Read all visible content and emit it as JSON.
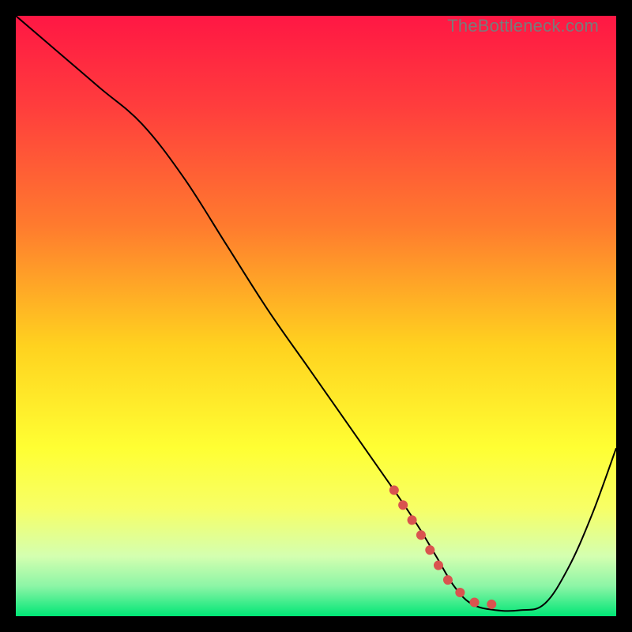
{
  "watermark": "TheBottleneck.com",
  "chart_data": {
    "type": "line",
    "title": "",
    "xlabel": "",
    "ylabel": "",
    "xlim": [
      0,
      100
    ],
    "ylim": [
      0,
      100
    ],
    "grid": false,
    "legend": false,
    "background_gradient": {
      "stops": [
        {
          "offset": 0.0,
          "color": "#ff1744"
        },
        {
          "offset": 0.15,
          "color": "#ff3d3d"
        },
        {
          "offset": 0.35,
          "color": "#ff7b2e"
        },
        {
          "offset": 0.55,
          "color": "#ffd21f"
        },
        {
          "offset": 0.72,
          "color": "#ffff33"
        },
        {
          "offset": 0.82,
          "color": "#f7ff66"
        },
        {
          "offset": 0.9,
          "color": "#d4ffb0"
        },
        {
          "offset": 0.95,
          "color": "#8cf5a6"
        },
        {
          "offset": 1.0,
          "color": "#00e676"
        }
      ]
    },
    "series": [
      {
        "name": "bottleneck-curve",
        "color": "#000000",
        "stroke_width": 2,
        "x": [
          0.0,
          7.0,
          14.0,
          21.0,
          28.0,
          35.0,
          42.0,
          49.0,
          56.0,
          63.0,
          67.0,
          70.0,
          73.0,
          76.0,
          80.0,
          84.0,
          88.0,
          92.0,
          96.0,
          100.0
        ],
        "y": [
          100.0,
          94.0,
          88.0,
          82.0,
          73.0,
          62.0,
          51.0,
          41.0,
          31.0,
          21.0,
          15.0,
          10.0,
          5.0,
          2.0,
          1.0,
          1.0,
          2.0,
          8.0,
          17.0,
          28.0
        ]
      },
      {
        "name": "optimal-range-marker",
        "color": "#d9534f",
        "stroke_width": 12,
        "linecap": "round",
        "dash": "0.1 22",
        "x": [
          63.0,
          66.0,
          69.0,
          72.0,
          76.0,
          79.0,
          82.0
        ],
        "y": [
          21.0,
          16.0,
          11.0,
          6.0,
          2.5,
          2.0,
          2.0
        ]
      }
    ]
  }
}
